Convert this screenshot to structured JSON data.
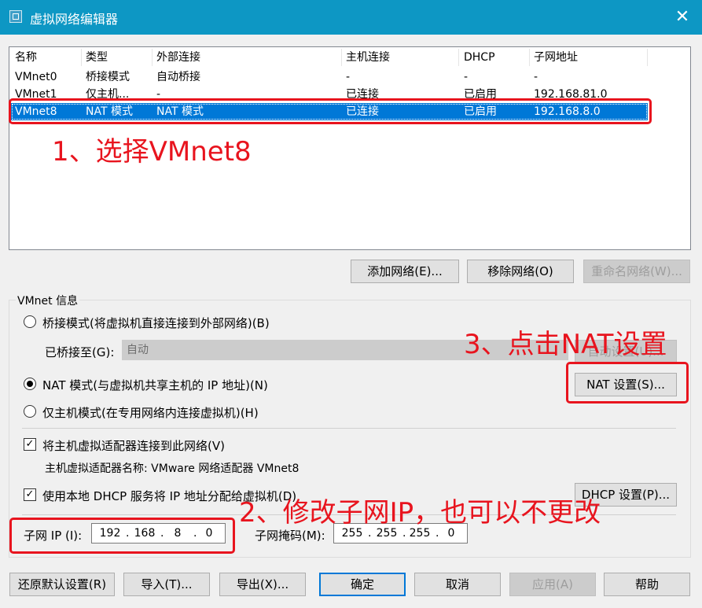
{
  "window": {
    "title": "虚拟网络编辑器",
    "close_glyph": "✕",
    "icon": "network-editor-icon"
  },
  "network_list": {
    "columns": [
      "名称",
      "类型",
      "外部连接",
      "主机连接",
      "DHCP",
      "子网地址"
    ],
    "rows": [
      {
        "name": "VMnet0",
        "type": "桥接模式",
        "external": "自动桥接",
        "host": "-",
        "dhcp": "-",
        "subnet": "-"
      },
      {
        "name": "VMnet1",
        "type": "仅主机...",
        "external": "-",
        "host": "已连接",
        "dhcp": "已启用",
        "subnet": "192.168.81.0"
      },
      {
        "name": "VMnet8",
        "type": "NAT 模式",
        "external": "NAT 模式",
        "host": "已连接",
        "dhcp": "已启用",
        "subnet": "192.168.8.0",
        "selected": true
      }
    ]
  },
  "list_buttons": {
    "add": "添加网络(E)...",
    "remove": "移除网络(O)",
    "rename": "重命名网络(W)..."
  },
  "vmnet_info": {
    "group_label": "VMnet 信息",
    "bridged_radio": "桥接模式(将虚拟机直接连接到外部网络)(B)",
    "bridged_to_label": "已桥接至(G):",
    "bridged_to_value": "自动",
    "auto_settings_button": "自动设置(U)...",
    "nat_radio": "NAT 模式(与虚拟机共享主机的 IP 地址)(N)",
    "nat_settings_button": "NAT 设置(S)...",
    "hostonly_radio": "仅主机模式(在专用网络内连接虚拟机)(H)",
    "connect_adapter_checkbox": "将主机虚拟适配器连接到此网络(V)",
    "adapter_name": "主机虚拟适配器名称: VMware 网络适配器 VMnet8",
    "dhcp_checkbox": "使用本地 DHCP 服务将 IP 地址分配给虚拟机(D)",
    "dhcp_settings_button": "DHCP 设置(P)...",
    "subnet_ip_label": "子网 IP (I):",
    "subnet_ip": [
      "192",
      "168",
      "8",
      "0"
    ],
    "subnet_mask_label": "子网掩码(M):",
    "subnet_mask": [
      "255",
      "255",
      "255",
      "0"
    ]
  },
  "bottom_buttons": {
    "restore": "还原默认设置(R)",
    "import": "导入(T)...",
    "export": "导出(X)...",
    "ok": "确定",
    "cancel": "取消",
    "apply": "应用(A)",
    "help": "帮助"
  },
  "annotations": {
    "step1": "1、选择VMnet8",
    "step2": "2、修改子网IP，也可以不更改",
    "step3": "3、点击NAT设置",
    "color": "#e8141e"
  },
  "colors": {
    "titlebar": "#0d97c4",
    "selection": "#0078d7"
  }
}
